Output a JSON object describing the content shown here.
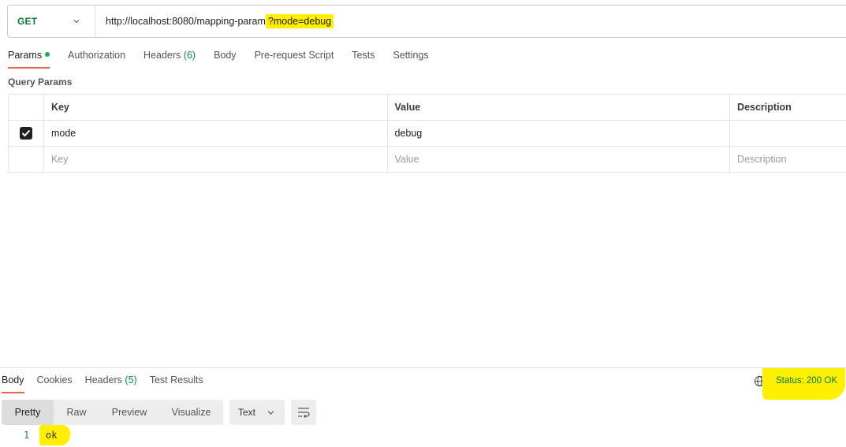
{
  "request": {
    "method": "GET",
    "url_base": "http://localhost:8080/mapping-param",
    "url_query": "?mode=debug"
  },
  "request_tabs": [
    {
      "label": "Params",
      "active": true
    },
    {
      "label": "Authorization"
    },
    {
      "label": "Headers",
      "count": "(6)"
    },
    {
      "label": "Body"
    },
    {
      "label": "Pre-request Script"
    },
    {
      "label": "Tests"
    },
    {
      "label": "Settings"
    }
  ],
  "query_params": {
    "title": "Query Params",
    "headers": {
      "key": "Key",
      "value": "Value",
      "description": "Description"
    },
    "rows": [
      {
        "key": "mode",
        "value": "debug",
        "description": "",
        "checked": true
      }
    ],
    "placeholder": {
      "key": "Key",
      "value": "Value",
      "description": "Description"
    }
  },
  "response_tabs": [
    {
      "label": "Body",
      "active": true
    },
    {
      "label": "Cookies"
    },
    {
      "label": "Headers",
      "count": "(5)"
    },
    {
      "label": "Test Results"
    }
  ],
  "status": "Status: 200 OK",
  "view_modes": [
    "Pretty",
    "Raw",
    "Preview",
    "Visualize"
  ],
  "format": "Text",
  "body": {
    "line_number": "1",
    "content": "ok"
  },
  "colors": {
    "accent": "#e8654a",
    "success": "#0b7a3e",
    "highlight": "#ffef00"
  }
}
